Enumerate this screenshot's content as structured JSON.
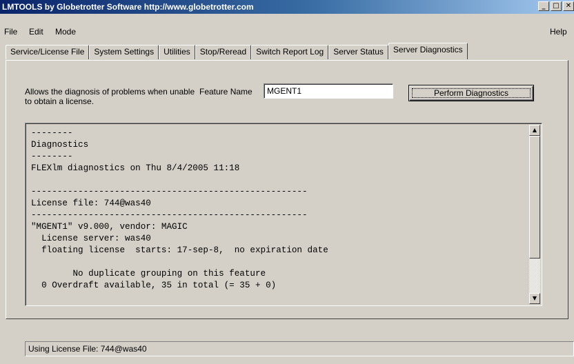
{
  "window": {
    "title": "LMTOOLS by Globetrotter Software http://www.globetrotter.com",
    "minimize": "_",
    "maximize": "□",
    "close": "✕"
  },
  "menu": {
    "file": "File",
    "edit": "Edit",
    "mode": "Mode",
    "help": "Help"
  },
  "tabs": [
    {
      "label": "Service/License File"
    },
    {
      "label": "System Settings"
    },
    {
      "label": "Utilities"
    },
    {
      "label": "Stop/Reread"
    },
    {
      "label": "Switch Report Log"
    },
    {
      "label": "Server Status"
    },
    {
      "label": "Server Diagnostics"
    }
  ],
  "active_tab": "Server Diagnostics",
  "diagnostics": {
    "description": "Allows the diagnosis of problems when unable to obtain a license.",
    "feature_label": "Feature Name",
    "feature_value": "MGENT1",
    "button_label": "Perform Diagnostics",
    "output_lines": [
      "--------",
      "Diagnostics",
      "--------",
      "FLEXlm diagnostics on Thu 8/4/2005 11:18",
      "",
      "-----------------------------------------------------",
      "License file: 744@was40",
      "-----------------------------------------------------",
      "\"MGENT1\" v9.000, vendor: MAGIC",
      "  License server: was40",
      "  floating license  starts: 17-sep-8,  no expiration date",
      "",
      "        No duplicate grouping on this feature",
      "  0 Overdraft available, 35 in total (= 35 + 0)"
    ]
  },
  "scrollbar": {
    "up_arrow": "▲",
    "down_arrow": "▼"
  },
  "status": {
    "text": "Using License File:  744@was40"
  }
}
